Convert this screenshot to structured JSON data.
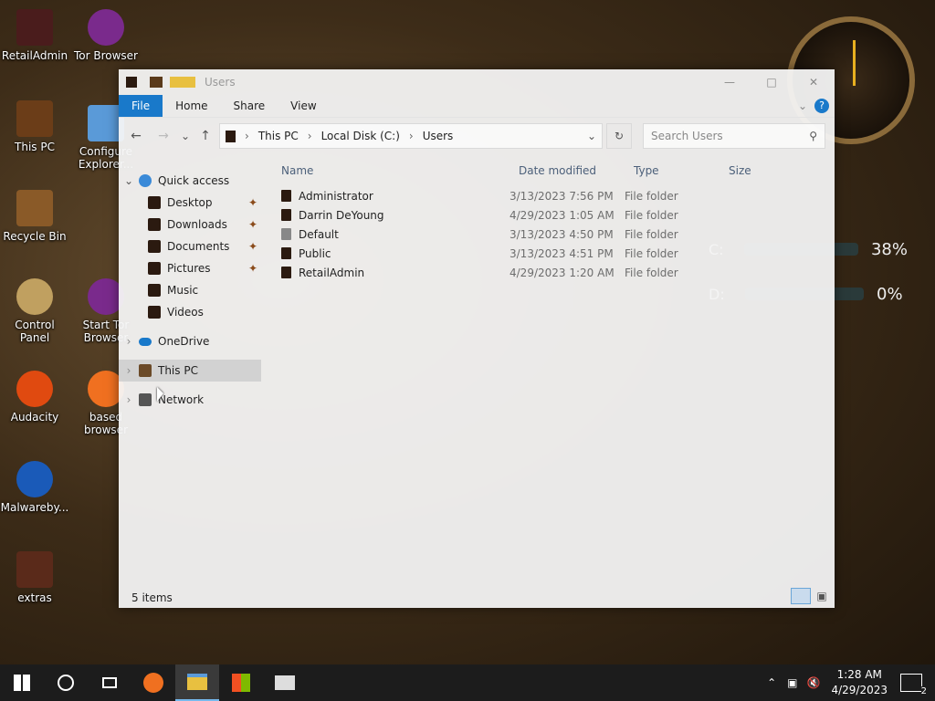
{
  "desktop": {
    "icons": [
      {
        "label": "RetailAdmin"
      },
      {
        "label": "Tor Browser"
      },
      {
        "label": "This PC"
      },
      {
        "label": "Configure Explorer..."
      },
      {
        "label": "Recycle Bin"
      },
      {
        "label": "Control Panel"
      },
      {
        "label": "Start Tor Browser"
      },
      {
        "label": "Audacity"
      },
      {
        "label": "based browser"
      },
      {
        "label": "Malwareby..."
      },
      {
        "label": "extras"
      }
    ],
    "gauges": [
      {
        "label": "C:",
        "value": "38%"
      },
      {
        "label": "D:",
        "value": "0%"
      }
    ]
  },
  "explorer": {
    "title": "Users",
    "ribbon_tabs": [
      "File",
      "Home",
      "Share",
      "View"
    ],
    "breadcrumb": [
      "This PC",
      "Local Disk (C:)",
      "Users"
    ],
    "search_placeholder": "Search Users",
    "columns": [
      "Name",
      "Date modified",
      "Type",
      "Size"
    ],
    "nav": {
      "quick_access": "Quick access",
      "quick_items": [
        {
          "label": "Desktop",
          "pinned": true
        },
        {
          "label": "Downloads",
          "pinned": true
        },
        {
          "label": "Documents",
          "pinned": true
        },
        {
          "label": "Pictures",
          "pinned": true
        },
        {
          "label": "Music",
          "pinned": false
        },
        {
          "label": "Videos",
          "pinned": false
        }
      ],
      "onedrive": "OneDrive",
      "this_pc": "This PC",
      "network": "Network"
    },
    "files": [
      {
        "name": "Administrator",
        "date": "3/13/2023 7:56 PM",
        "type": "File folder",
        "size": ""
      },
      {
        "name": "Darrin DeYoung",
        "date": "4/29/2023 1:05 AM",
        "type": "File folder",
        "size": ""
      },
      {
        "name": "Default",
        "date": "3/13/2023 4:50 PM",
        "type": "File folder",
        "size": ""
      },
      {
        "name": "Public",
        "date": "3/13/2023 4:51 PM",
        "type": "File folder",
        "size": ""
      },
      {
        "name": "RetailAdmin",
        "date": "4/29/2023 1:20 AM",
        "type": "File folder",
        "size": ""
      }
    ],
    "status": "5 items"
  },
  "taskbar": {
    "time": "1:28 AM",
    "date": "4/29/2023",
    "notif_count": "2"
  },
  "colors": {
    "file_tab": "#1979ca",
    "taskbar": "#1c1c1c"
  }
}
